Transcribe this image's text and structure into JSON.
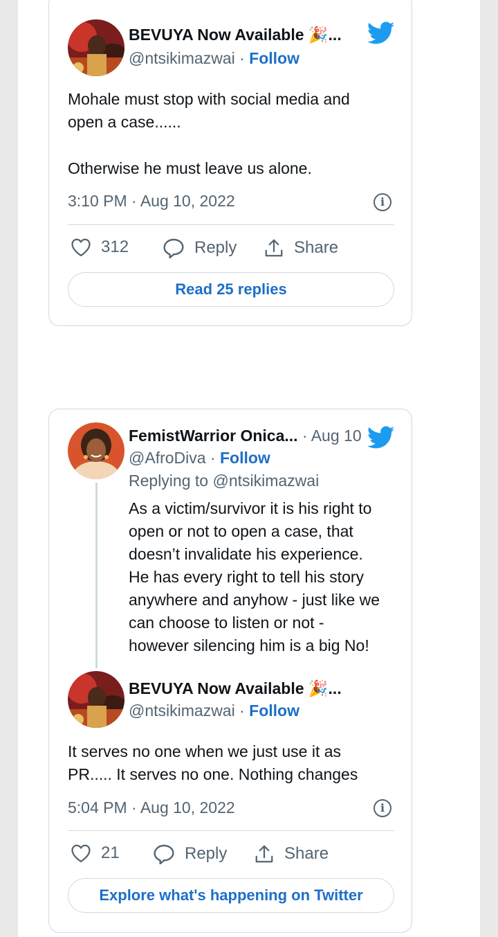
{
  "tweet1": {
    "name": "BEVUYA Now Available 🎉...",
    "handle": "@ntsikimazwai",
    "follow": "Follow",
    "text_line1": "Mohale must stop with social media and",
    "text_line2": "open a case......",
    "text_line3": "Otherwise he must leave us alone.",
    "time": "3:10 PM · Aug 10, 2022",
    "likes": "312",
    "reply": "Reply",
    "share": "Share",
    "read_replies": "Read 25 replies"
  },
  "tweet2": {
    "reply_author": {
      "name": "FemistWarrior Onica...",
      "date": "Aug 10",
      "handle": "@AfroDiva",
      "follow": "Follow",
      "replying_prefix": "Replying to",
      "replying_to": "@ntsikimazwai",
      "lines": [
        "As a victim/survivor it is his right to",
        "open or not to open a case, that",
        "doesn’t invalidate his experience.",
        "He has every right to tell his story",
        "anywhere and anyhow - just like we",
        "can choose to listen or not -",
        "however silencing him is a big No!"
      ]
    },
    "name": "BEVUYA Now Available 🎉...",
    "handle": "@ntsikimazwai",
    "follow": "Follow",
    "text_line1": "It serves no one when we just use it as",
    "text_line2": "PR..... It serves no one. Nothing changes",
    "time": "5:04 PM · Aug 10, 2022",
    "likes": "21",
    "reply": "Reply",
    "share": "Share",
    "explore": "Explore what's happening on Twitter"
  },
  "colors": {
    "accent": "#1d6fc7",
    "twitter_blue": "#1d9bf0",
    "muted": "#536471",
    "border": "#cfd9de"
  },
  "icons": [
    "twitter-bird-icon",
    "info-icon",
    "heart-icon",
    "reply-bubble-icon",
    "share-icon"
  ]
}
